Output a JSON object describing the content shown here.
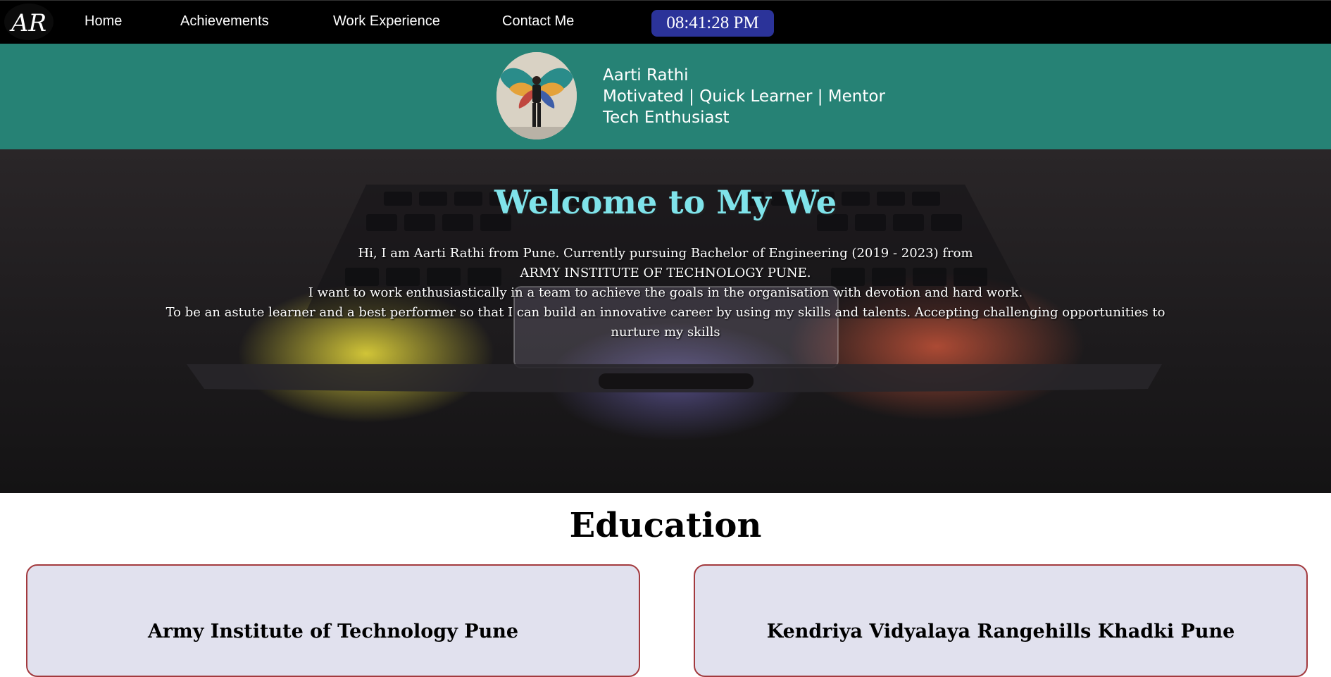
{
  "logo": {
    "text": "AR"
  },
  "nav": {
    "items": [
      {
        "label": "Home"
      },
      {
        "label": "Achievements"
      },
      {
        "label": "Work Experience"
      },
      {
        "label": "Contact Me"
      }
    ],
    "clock": "08:41:28 PM"
  },
  "profile": {
    "name": "Aarti Rathi",
    "tagline": "Motivated | Quick Learner | Mentor",
    "subtitle": "Tech Enthusiast"
  },
  "hero": {
    "title": "Welcome to My We",
    "lines": [
      "Hi, I am Aarti Rathi from Pune. Currently pursuing Bachelor of Engineering (2019 - 2023) from",
      "ARMY INSTITUTE OF TECHNOLOGY PUNE.",
      "I want to work enthusiastically in a team to achieve the goals in the organisation with devotion and hard work.",
      "To be an astute learner and a best performer so that I can build an innovative career by using my skills and talents. Accepting challenging opportunities to nurture my skills"
    ]
  },
  "education": {
    "heading": "Education",
    "cards": [
      {
        "title": "Army Institute of Technology Pune"
      },
      {
        "title": "Kendriya Vidyalaya Rangehills Khadki Pune"
      }
    ]
  },
  "colors": {
    "navbar": "#000000",
    "clock_bg": "#2b3399",
    "profile_bg": "#268275",
    "hero_title": "#7fe3ea",
    "card_bg": "#e1e1ee",
    "card_border": "#a33a3e"
  }
}
